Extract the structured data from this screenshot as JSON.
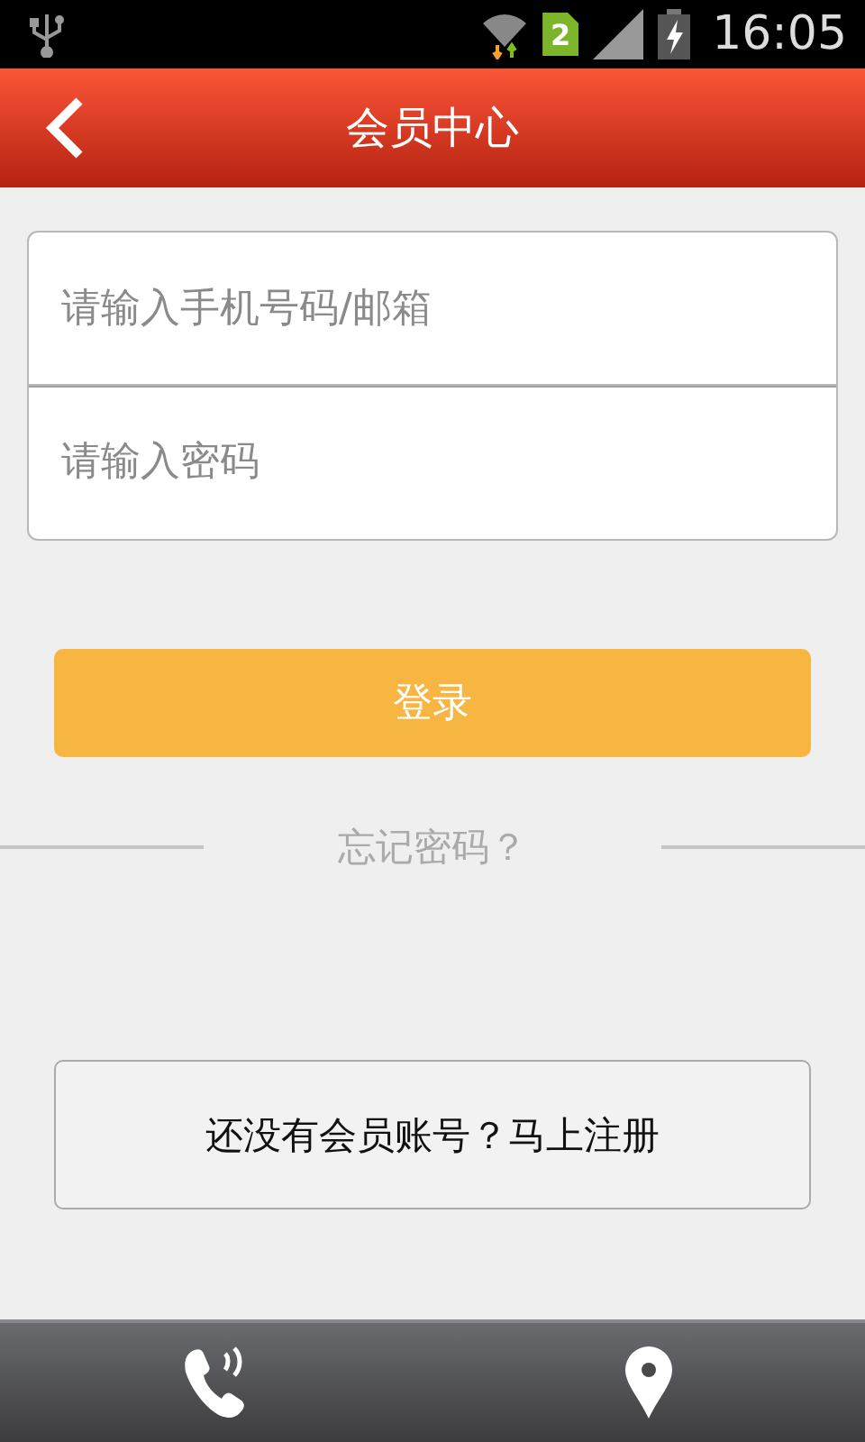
{
  "status_bar": {
    "sim_slot": "2",
    "time": "16:05"
  },
  "header": {
    "title": "会员中心"
  },
  "fields": [
    {
      "placeholder": "请输入手机号码/邮箱"
    },
    {
      "placeholder": "请输入密码"
    }
  ],
  "login_button": "登录",
  "forgot_password": "忘记密码？",
  "register_button": "还没有会员账号？马上注册"
}
